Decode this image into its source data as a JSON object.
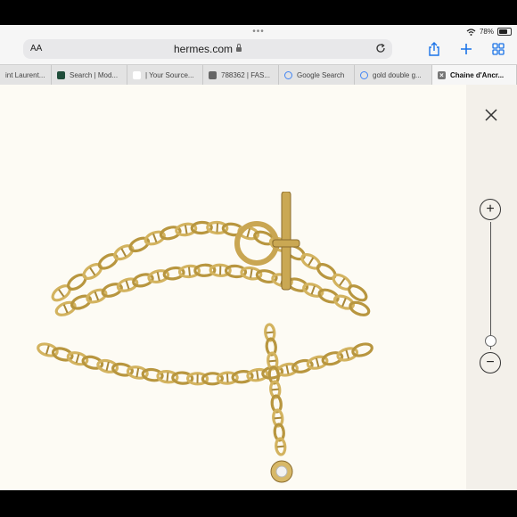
{
  "status": {
    "battery": "78%",
    "battery_level": 0.78
  },
  "browser": {
    "aa_label": "AA",
    "url": "hermes.com",
    "tabs": [
      {
        "label": "int Laurent...",
        "favicon": "generic-icon",
        "color": "#d9d9d9"
      },
      {
        "label": "Search | Mod...",
        "favicon": "square-icon",
        "color": "#1f4d3a"
      },
      {
        "label": "| Your Source...",
        "favicon": "dash-icon",
        "color": "#ffffff"
      },
      {
        "label": "788362 | FAS...",
        "favicon": "globe-icon",
        "color": "#666666"
      },
      {
        "label": "Google Search",
        "favicon": "google-icon",
        "color": "#4285f4"
      },
      {
        "label": "gold double g...",
        "favicon": "google-icon",
        "color": "#4285f4"
      },
      {
        "label": "Chaine d'Ancr...",
        "favicon": "close-tab-icon",
        "color": "#666666"
      }
    ]
  },
  "viewer": {
    "close_icon": "close-icon",
    "zoom_in_icon": "plus-icon",
    "zoom_out_icon": "minus-icon",
    "zoom_level": 0.07
  },
  "colors": {
    "page_bg": "#fdfbf4",
    "gold": "#c9a652",
    "gold_dark": "#8a6b2c"
  }
}
